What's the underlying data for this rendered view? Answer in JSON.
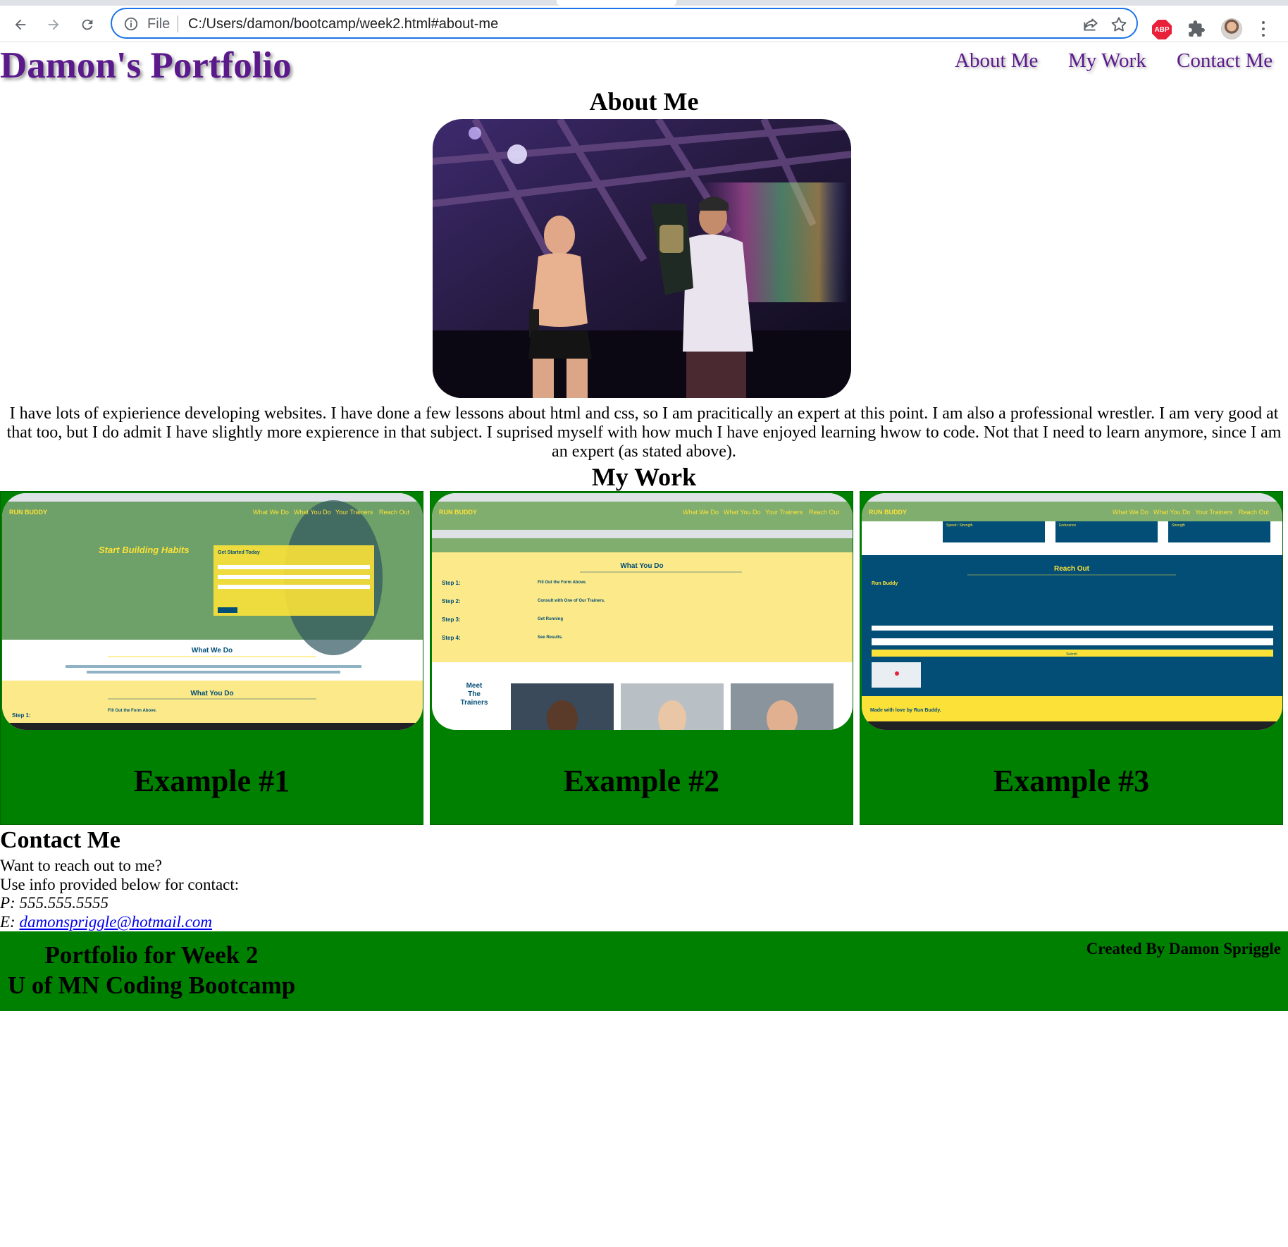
{
  "browser": {
    "scheme_label": "File",
    "url": "C:/Users/damon/bootcamp/week2.html#about-me",
    "extension_badge": "ABP",
    "icons": [
      "back-arrow-icon",
      "forward-arrow-icon",
      "reload-icon",
      "info-icon",
      "share-icon",
      "star-icon",
      "adblock-icon",
      "puzzle-icon",
      "profile-avatar",
      "more-vert-icon"
    ]
  },
  "header": {
    "title": "Damon's Portfolio",
    "nav": [
      {
        "label": "About Me"
      },
      {
        "label": "My Work"
      },
      {
        "label": "Contact Me"
      }
    ]
  },
  "about": {
    "heading": "About Me",
    "paragraph": "I have lots of expierience developing websites. I have done a few lessons about html and css, so I am pracitically an expert at this point. I am also a professional wrestler. I am very good at that too, but I do admit I have slightly more expierence in that subject. I suprised myself with how much I have enjoyed learning hwow to code. Not that I need to learn anymore, since I am an expert (as stated above)."
  },
  "work": {
    "heading": "My Work",
    "items": [
      {
        "label": "Example #1",
        "shot": {
          "brand": "RUN BUDDY",
          "nav": [
            "What We Do",
            "What You Do",
            "Your Trainers",
            "Reach Out"
          ],
          "hero_title": "Start Building Habits",
          "form_title": "Get Started Today",
          "section1": "What We Do",
          "section2": "What You Do",
          "step": "Step 1:",
          "step_text": "Fill Out the Form Above."
        }
      },
      {
        "label": "Example #2",
        "shot": {
          "brand": "RUN BUDDY",
          "nav": [
            "What We Do",
            "What You Do",
            "Your Trainers",
            "Reach Out"
          ],
          "section": "What You Do",
          "steps": [
            {
              "label": "Step 1:",
              "text": "Fill Out the Form Above."
            },
            {
              "label": "Step 2:",
              "text": "Consult with One of Our Trainers."
            },
            {
              "label": "Step 3:",
              "text": "Get Running"
            },
            {
              "label": "Step 4:",
              "text": "See Results."
            }
          ],
          "trainers_title": [
            "Meet",
            "The",
            "Trainers"
          ]
        }
      },
      {
        "label": "Example #3",
        "shot": {
          "brand": "RUN BUDDY",
          "nav": [
            "What We Do",
            "What You Do",
            "Your Trainers",
            "Reach Out"
          ],
          "boxes": [
            "Speed / Strength",
            "Endurance",
            "Strength"
          ],
          "section": "Reach Out",
          "contact_title": "Run Buddy",
          "submit": "Submit",
          "footer_note": "Made with love by Run Buddy."
        }
      }
    ]
  },
  "contact": {
    "heading": "Contact Me",
    "line1": "Want to reach out to me?",
    "line2": "Use info provided below for contact:",
    "phone_prefix": "P:",
    "phone": "555.555.5555",
    "email_prefix": "E:",
    "email": "damonspriggle@hotmail.com"
  },
  "footer": {
    "line1": "Portfolio for Week 2",
    "line2": "U of MN Coding Bootcamp",
    "credit": "Created By Damon Spriggle"
  },
  "colors": {
    "title_purple": "#5b1a8c",
    "card_green": "#008000",
    "link_blue": "#0000ee",
    "runbuddy_navy": "#024e76",
    "runbuddy_yellow": "#fce138"
  }
}
